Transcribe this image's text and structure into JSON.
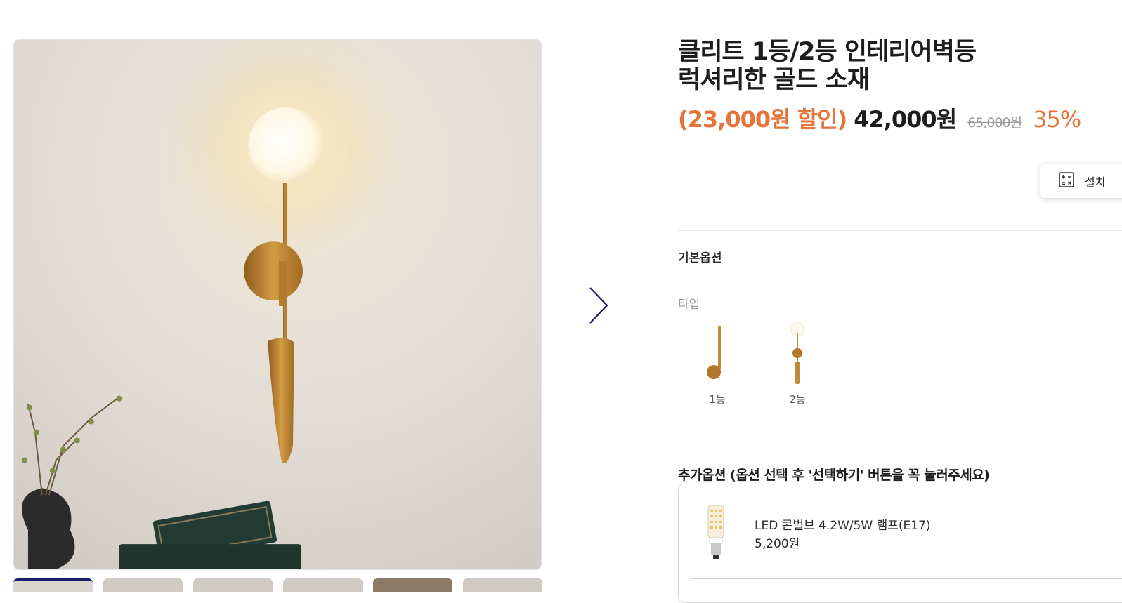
{
  "product": {
    "title_line1": "클리트 1등/2등 인테리어벽등",
    "title_line2": "럭셔리한 골드 소재"
  },
  "pricing": {
    "discount_amount": "(23,000원 할인)",
    "sale_price": "42,000원",
    "original_price": "65,000원",
    "discount_rate": "35%",
    "accent_color": "#e4743a"
  },
  "install_button": {
    "label": "설치",
    "icon": "calculator-icon"
  },
  "options": {
    "basic_heading": "기본옵션",
    "type_label": "타입",
    "types": [
      {
        "label": "1등"
      },
      {
        "label": "2등"
      }
    ]
  },
  "extra_options": {
    "heading": "추가옵션 (옵션 선택 후 '선택하기' 버튼을 꼭 눌러주세요)",
    "items": [
      {
        "name": "LED 콘벌브 4.2W/5W 램프(E17)",
        "price": "5,200원",
        "icon": "led-bulb-icon"
      }
    ]
  },
  "gallery": {
    "next_icon": "chevron-right-icon",
    "thumbnail_count": 6
  }
}
